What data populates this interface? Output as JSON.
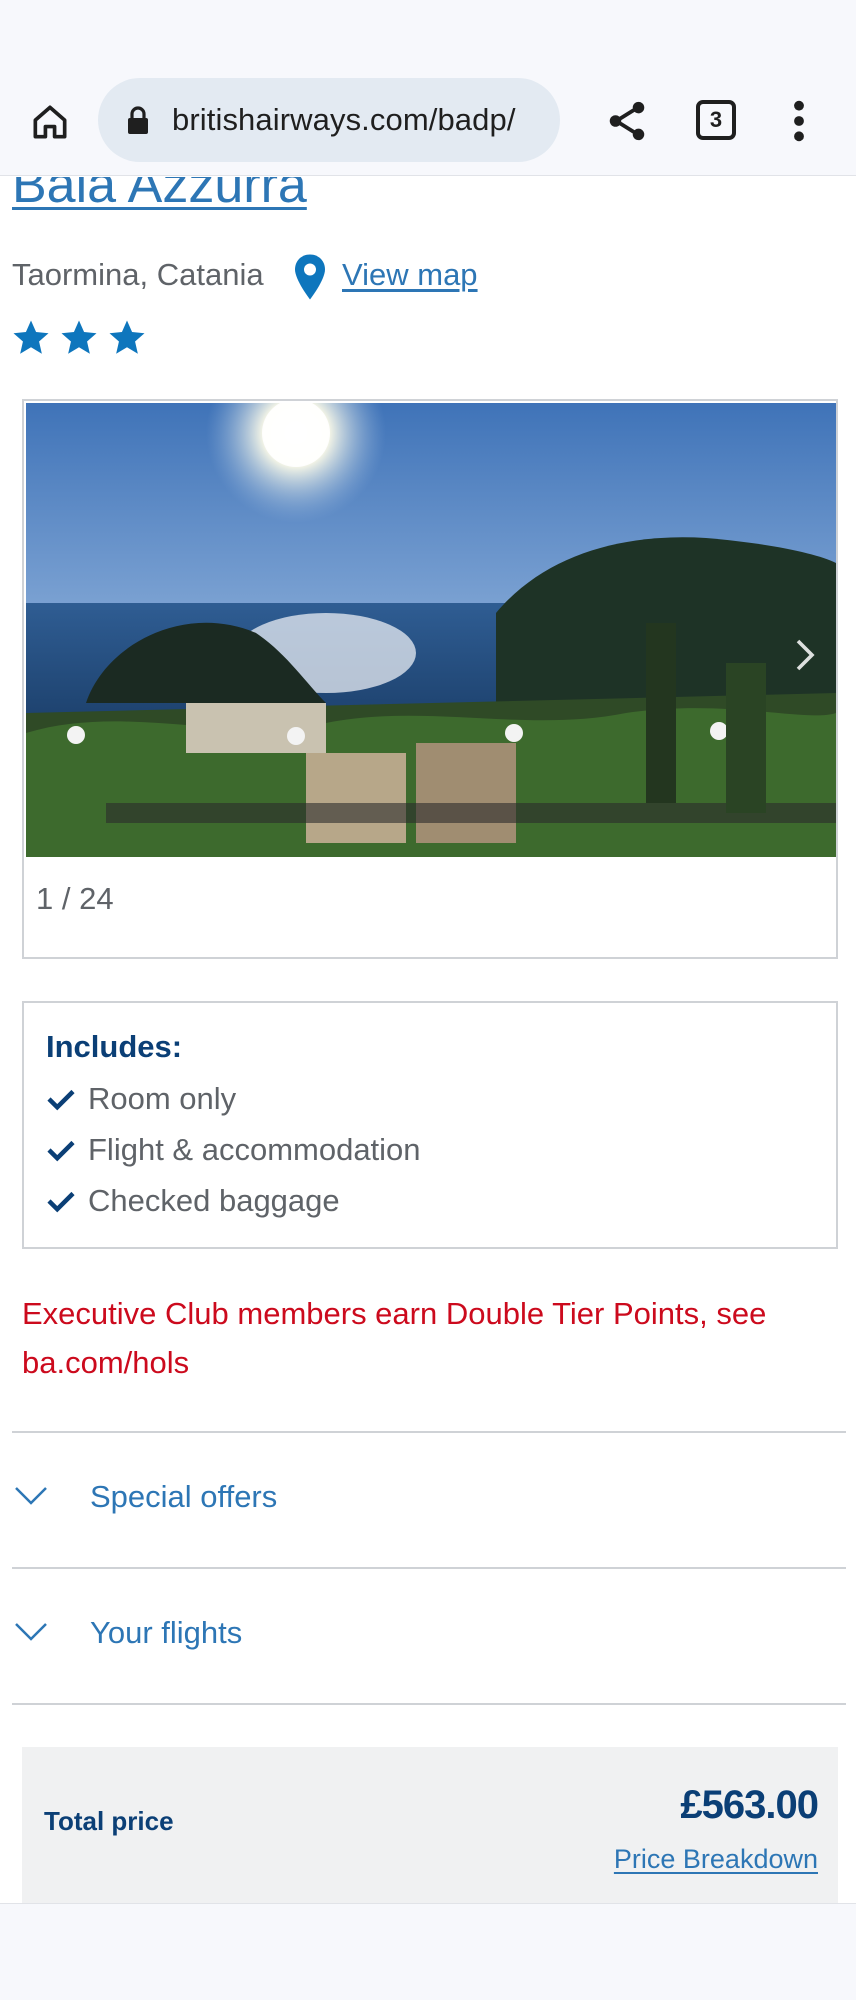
{
  "browser": {
    "url": "britishairways.com/badp/",
    "tab_count": "3",
    "icons": {
      "home": "home-icon",
      "lock": "lock-icon",
      "share": "share-icon",
      "tabs": "tab-switcher-icon",
      "menu": "more-vert-icon"
    }
  },
  "hotel": {
    "name": "Baia Azzurra",
    "location": "Taormina, Catania",
    "view_map_label": "View map",
    "star_rating": 3,
    "star_color": "#0e76bd"
  },
  "gallery": {
    "counter": "1 / 24",
    "next_icon": "chevron-right-icon"
  },
  "includes": {
    "title": "Includes:",
    "items": [
      "Room only",
      "Flight & accommodation",
      "Checked baggage"
    ]
  },
  "promo": {
    "text": "Executive Club members earn Double Tier Points, see ba.com/hols",
    "color": "#cc0a1d"
  },
  "accordions": [
    {
      "label": "Special offers",
      "expanded": false
    },
    {
      "label": "Your flights",
      "expanded": false
    }
  ],
  "pricing": {
    "total_label": "Total price",
    "total_amount": "£563.00",
    "breakdown_label": "Price Breakdown"
  },
  "colors": {
    "link_blue": "#2d76b5",
    "navy": "#0b3f76",
    "panel_grey": "#f0f1f2"
  }
}
